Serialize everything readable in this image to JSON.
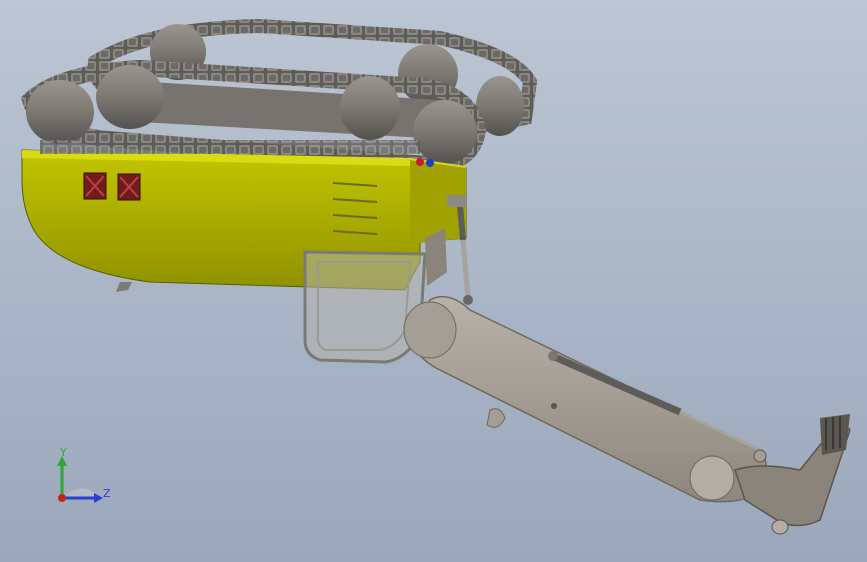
{
  "viewport": {
    "background_top": "#bcc6d4",
    "background_bottom": "#9ba8bb"
  },
  "model": {
    "body_color": "#b5b800",
    "track_color": "#6c6a66",
    "roller_color": "#807d78",
    "arm_color": "#a59e96",
    "bucket_color": "#8a847b",
    "hatch_color": "#6e1c1c"
  },
  "triad": {
    "y_label": "Y",
    "z_label": "Z",
    "y_color": "#2ea82e",
    "z_color": "#2a3fcf",
    "x_color": "#cc2020"
  }
}
